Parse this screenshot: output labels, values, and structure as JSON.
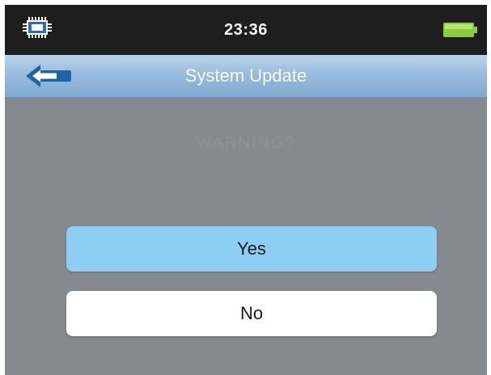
{
  "status_bar": {
    "time": "23:36",
    "left_icon": "chip-icon",
    "right_icon": "battery-icon",
    "battery_color": "#8ccc3c"
  },
  "header": {
    "back_icon": "back-arrow-icon",
    "title": "System Update"
  },
  "dialog": {
    "message": "WARNING?",
    "yes_label": "Yes",
    "no_label": "No"
  },
  "colors": {
    "background": "#848a8f",
    "status_bar": "#1e1e1e",
    "title_bar": "#93b9db",
    "yes_button": "#8dcff2",
    "no_button": "#ffffff"
  }
}
